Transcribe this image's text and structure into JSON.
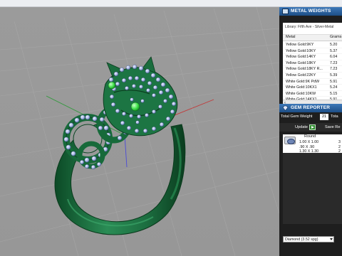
{
  "metal_weights": {
    "title": "METAL WEIGHTS",
    "library": "Library: Fifth Ave - Silver-Metal",
    "col_metal": "Metal",
    "col_grams": "Grams",
    "rows": [
      {
        "metal": "Yellow Gold:9KY",
        "grams": "5.20"
      },
      {
        "metal": "Yellow Gold:10KY",
        "grams": "5.37"
      },
      {
        "metal": "Yellow Gold:14KY",
        "grams": "6.04"
      },
      {
        "metal": "Yellow Gold:18KY",
        "grams": "7.23"
      },
      {
        "metal": "Yellow Gold:18KY R...",
        "grams": "7.23"
      },
      {
        "metal": "Yellow Gold:22KY",
        "grams": "5.39"
      },
      {
        "metal": "White Gold:9K PdW",
        "grams": "5.91"
      },
      {
        "metal": "White Gold:10KX1",
        "grams": "5.24"
      },
      {
        "metal": "White Gold:10KW",
        "grams": "5.15"
      },
      {
        "metal": "White Gold:14KX1",
        "grams": "5.91"
      },
      {
        "metal": "White Gold:14K PdW",
        "grams": "6.74"
      }
    ],
    "scroll_left": "‹"
  },
  "gem_reporter": {
    "title": "GEM REPORTER",
    "total_gem_weight_label": "Total Gem Weight",
    "total_gem_weight_value": "21",
    "total_label": "Tota",
    "update_label": "Update",
    "save_label": "Save Re",
    "shape": "Round",
    "rows": [
      {
        "size": "1.00 X 1.00",
        "count": "3"
      },
      {
        "size": ".90 X .90",
        "count": "2"
      },
      {
        "size": "1.30 X 1.30",
        "count": "2"
      }
    ],
    "dropdown_value": "Diamond    (3.52 spg)"
  },
  "colors": {
    "ring": "#1f7a45",
    "ring_dark": "#0d4424",
    "gem": "#a9b8e6",
    "eye": "#3fe04a",
    "panel_title": "#2a65a6"
  }
}
